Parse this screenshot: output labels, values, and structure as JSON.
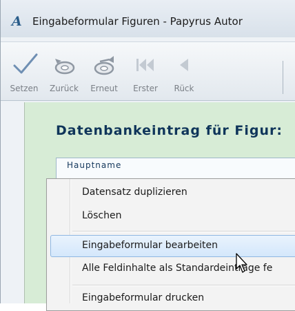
{
  "window": {
    "title": "Eingabeformular Figuren - Papyrus Autor",
    "app_icon": "papyrus-logo"
  },
  "toolbar": {
    "buttons": [
      {
        "label": "Setzen",
        "icon": "checkmark-icon",
        "color": "#6f8fb3"
      },
      {
        "label": "Zurück",
        "icon": "undo-icon",
        "color": "#8f98a3"
      },
      {
        "label": "Erneut",
        "icon": "redo-icon",
        "color": "#8f98a3"
      },
      {
        "label": "Erster",
        "icon": "first-record-icon",
        "color": "#c3cad2"
      },
      {
        "label": "Rück",
        "icon": "previous-record-icon",
        "color": "#c3cad2"
      }
    ]
  },
  "form": {
    "heading": "Datenbankeintrag für Figur:",
    "field_label": "Hauptname",
    "background": "#d7ecd6"
  },
  "context_menu": {
    "items": [
      {
        "label": "Datensatz duplizieren"
      },
      {
        "label": "Löschen"
      },
      {
        "label": "Eingabeformular bearbeiten",
        "highlighted": true
      },
      {
        "label": "Alle Feldinhalte als Standardeinträge fe"
      },
      {
        "label": "Eingabeformular drucken"
      }
    ],
    "highlight_color": "#d4e7fb"
  }
}
